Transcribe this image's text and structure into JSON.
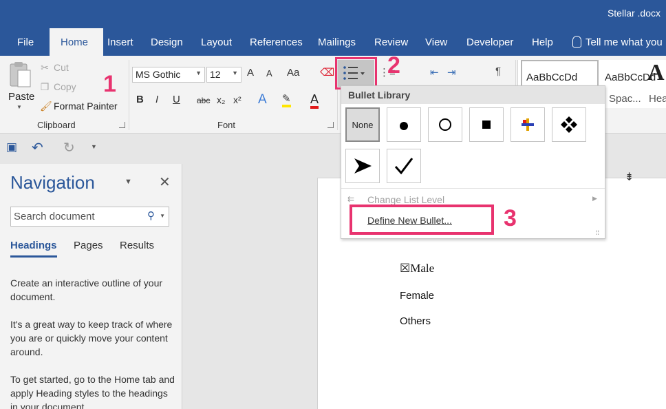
{
  "window": {
    "title": "Stellar .docx"
  },
  "tabs": [
    "File",
    "Home",
    "Insert",
    "Design",
    "Layout",
    "References",
    "Mailings",
    "Review",
    "View",
    "Developer",
    "Help"
  ],
  "tell_me": "Tell me what you",
  "clipboard": {
    "paste": "Paste",
    "cut": "Cut",
    "copy": "Copy",
    "format_painter": "Format Painter",
    "group_label": "Clipboard"
  },
  "font": {
    "name": "MS Gothic",
    "size": "12",
    "group_label": "Font",
    "bold": "B",
    "italic": "I",
    "underline": "U",
    "strike": "abc",
    "sub": "x₂",
    "super": "x²",
    "grow": "A",
    "shrink": "A",
    "case": "Aa",
    "effects": "A",
    "color": "A"
  },
  "paragraph": {
    "pilcrow": "¶"
  },
  "styles": [
    {
      "sample": "AaBbCcDd",
      "name": ""
    },
    {
      "sample": "AaBbCcDd",
      "name": "Spac..."
    },
    {
      "sample": "A",
      "name": "Hea"
    }
  ],
  "navigation": {
    "title": "Navigation",
    "search_placeholder": "Search document",
    "tabs": [
      "Headings",
      "Pages",
      "Results"
    ],
    "text1": "Create an interactive outline of your document.",
    "text2": "It's a great way to keep track of where you are or quickly move your content around.",
    "text3": "To get started, go to the Home tab and apply Heading styles to the headings in your document."
  },
  "bullet_menu": {
    "header": "Bullet Library",
    "none": "None",
    "change_level": "Change List Level",
    "define_new": "Define New Bullet..."
  },
  "document": {
    "lines": [
      "☒Male",
      "Female",
      "Others"
    ]
  },
  "badges": [
    "1",
    "2",
    "3"
  ],
  "colors": {
    "accent": "#2b579a",
    "highlight": "#e8336f"
  }
}
